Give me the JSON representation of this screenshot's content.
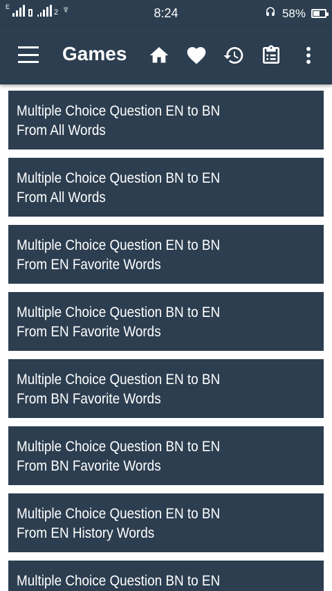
{
  "status_bar": {
    "sim1_label": "E",
    "sim2_label": "2",
    "usb_icon": "usb-icon",
    "time": "8:24",
    "headset_icon": "headset-icon",
    "battery_percent": "58%",
    "battery_level": 0.58
  },
  "app_bar": {
    "menu_icon": "menu-icon",
    "title": "Games",
    "actions": [
      "home-icon",
      "heart-icon",
      "history-icon",
      "clipboard-icon",
      "more-vert-icon"
    ]
  },
  "colors": {
    "primary": "#2c3e50",
    "text_on_primary": "#ffffff",
    "background": "#ffffff"
  },
  "games": [
    {
      "line1": "Multiple Choice Question EN to BN",
      "line2": "From All Words"
    },
    {
      "line1": "Multiple Choice Question BN to EN",
      "line2": "From All Words"
    },
    {
      "line1": "Multiple Choice Question EN to BN",
      "line2": "From EN Favorite Words"
    },
    {
      "line1": "Multiple Choice Question BN to EN",
      "line2": "From EN Favorite Words"
    },
    {
      "line1": "Multiple Choice Question EN to BN",
      "line2": "From BN Favorite Words"
    },
    {
      "line1": "Multiple Choice Question BN to EN",
      "line2": "From BN Favorite Words"
    },
    {
      "line1": "Multiple Choice Question EN to BN",
      "line2": "From EN History Words"
    },
    {
      "line1": "Multiple Choice Question BN to EN",
      "line2": ""
    }
  ]
}
